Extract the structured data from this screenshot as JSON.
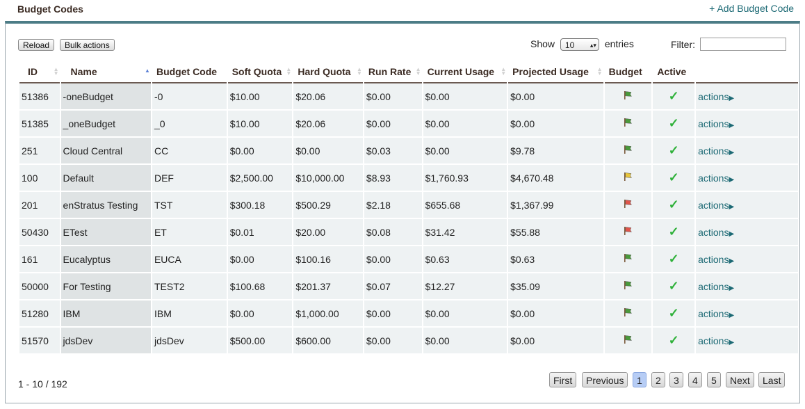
{
  "header": {
    "title": "Budget Codes",
    "add_link": "+ Add Budget Code"
  },
  "toolbar": {
    "reload": "Reload",
    "bulk": "Bulk actions",
    "show": "Show",
    "entries": "entries",
    "page_size": "10",
    "filter_label": "Filter:",
    "filter_value": ""
  },
  "columns": [
    "ID",
    "Name",
    "Budget Code",
    "Soft Quota",
    "Hard Quota",
    "Run Rate",
    "Current Usage",
    "Projected Usage",
    "Budget",
    "Active"
  ],
  "rows": [
    {
      "id": "51386",
      "name": "-oneBudget",
      "code": "-0",
      "soft": "$10.00",
      "hard": "$20.06",
      "rate": "$0.00",
      "current": "$0.00",
      "projected": "$0.00",
      "flag": "green",
      "action": "actions"
    },
    {
      "id": "51385",
      "name": "_oneBudget",
      "code": "_0",
      "soft": "$10.00",
      "hard": "$20.06",
      "rate": "$0.00",
      "current": "$0.00",
      "projected": "$0.00",
      "flag": "green",
      "action": "actions"
    },
    {
      "id": "251",
      "name": "Cloud Central",
      "code": "CC",
      "soft": "$0.00",
      "hard": "$0.00",
      "rate": "$0.03",
      "current": "$0.00",
      "projected": "$9.78",
      "flag": "green",
      "action": "actions"
    },
    {
      "id": "100",
      "name": "Default",
      "code": "DEF",
      "soft": "$2,500.00",
      "hard": "$10,000.00",
      "rate": "$8.93",
      "current": "$1,760.93",
      "projected": "$4,670.48",
      "flag": "yellow",
      "action": "actions"
    },
    {
      "id": "201",
      "name": "enStratus Testing",
      "code": "TST",
      "soft": "$300.18",
      "hard": "$500.29",
      "rate": "$2.18",
      "current": "$655.68",
      "projected": "$1,367.99",
      "flag": "red",
      "action": "actions"
    },
    {
      "id": "50430",
      "name": "ETest",
      "code": "ET",
      "soft": "$0.01",
      "hard": "$20.00",
      "rate": "$0.08",
      "current": "$31.42",
      "projected": "$55.88",
      "flag": "red",
      "action": "actions"
    },
    {
      "id": "161",
      "name": "Eucalyptus",
      "code": "EUCA",
      "soft": "$0.00",
      "hard": "$100.16",
      "rate": "$0.00",
      "current": "$0.63",
      "projected": "$0.63",
      "flag": "green",
      "action": "actions"
    },
    {
      "id": "50000",
      "name": "For Testing",
      "code": "TEST2",
      "soft": "$100.68",
      "hard": "$201.37",
      "rate": "$0.07",
      "current": "$12.27",
      "projected": "$35.09",
      "flag": "green",
      "action": "actions"
    },
    {
      "id": "51280",
      "name": "IBM",
      "code": "IBM",
      "soft": "$0.00",
      "hard": "$1,000.00",
      "rate": "$0.00",
      "current": "$0.00",
      "projected": "$0.00",
      "flag": "green",
      "action": "actions"
    },
    {
      "id": "51570",
      "name": "jdsDev",
      "code": "jdsDev",
      "soft": "$500.00",
      "hard": "$600.00",
      "rate": "$0.00",
      "current": "$0.00",
      "projected": "$0.00",
      "flag": "green",
      "action": "actions"
    }
  ],
  "footer": {
    "info": "1 - 10 / 192",
    "first": "First",
    "previous": "Previous",
    "pages": [
      "1",
      "2",
      "3",
      "4",
      "5"
    ],
    "current_page": "1",
    "next": "Next",
    "last": "Last"
  },
  "colors": {
    "accent": "#4c7c86",
    "link": "#1d6a75",
    "flag_green": "#4a9a3a",
    "flag_yellow": "#e8c53a",
    "flag_red": "#e0554a",
    "check": "#2fb13a"
  },
  "icons": {
    "flag": "flag-icon",
    "active": "checkmark-icon",
    "menu": "triangle-right-icon"
  }
}
